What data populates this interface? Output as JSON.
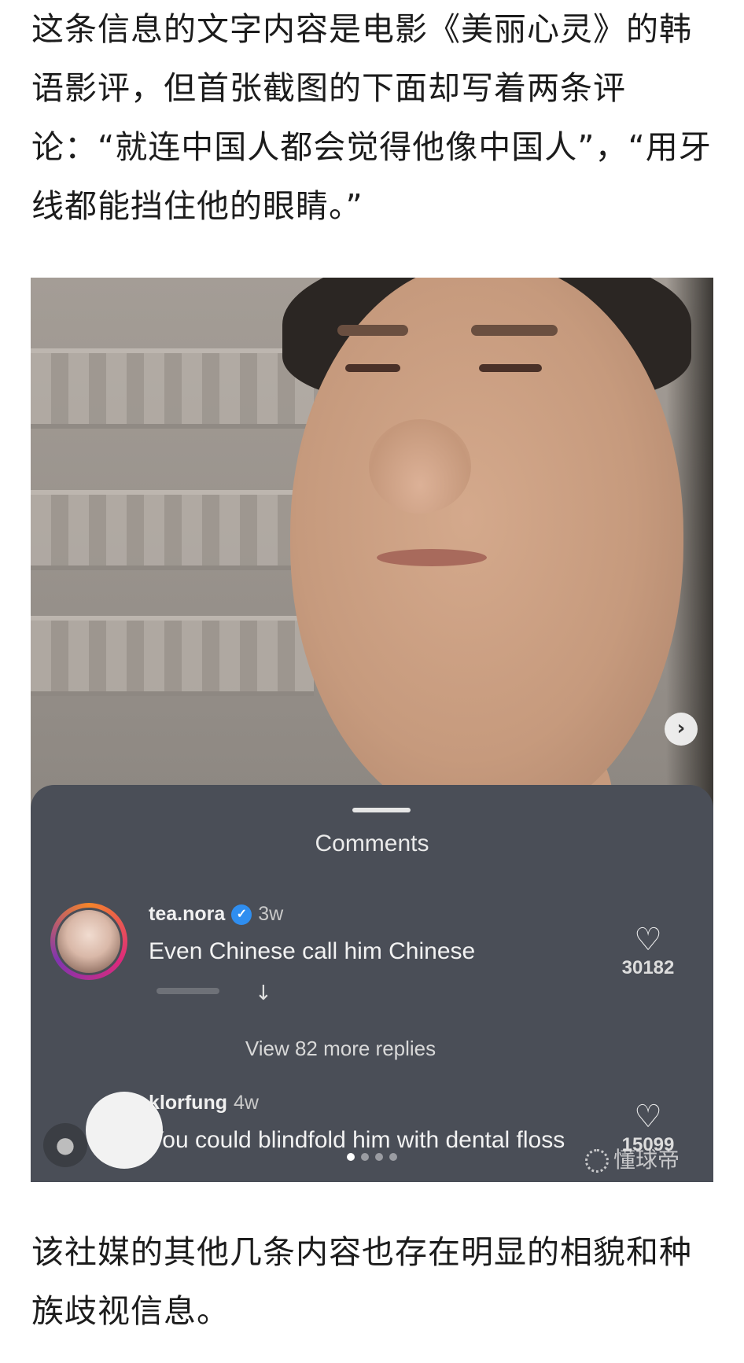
{
  "article": {
    "paragraph_top": "这条信息的文字内容是电影《美丽心灵》的韩语影评，但首张截图的下面却写着两条评论：“就连中国人都会觉得他像中国人”，“用牙线都能挡住他的眼睛。”",
    "paragraph_bottom": "该社媒的其他几条内容也存在明显的相貌和种族歧视信息。"
  },
  "screenshot": {
    "next_icon": "chevron-right-icon",
    "next_glyph": "›",
    "sheet_title": "Comments",
    "comments": [
      {
        "username": "tea.nora",
        "verified": true,
        "verified_glyph": "✓",
        "age": "3w",
        "text": "Even Chinese call him Chinese",
        "reply_glyph": "↓",
        "like_count": "30182",
        "heart_glyph": "♡"
      },
      {
        "username": "klorfung",
        "age": "4w",
        "text": "You could blindfold him with dental floss",
        "like_count": "15099",
        "heart_glyph": "♡"
      }
    ],
    "view_replies": "View 82 more replies",
    "user_glyph": "●",
    "carousel_active_index": 0,
    "carousel_count": 4
  },
  "watermark": {
    "text": "懂球帝"
  },
  "colors": {
    "sheet_bg": "#4a4e57",
    "verified_blue": "#2f8ef0"
  }
}
